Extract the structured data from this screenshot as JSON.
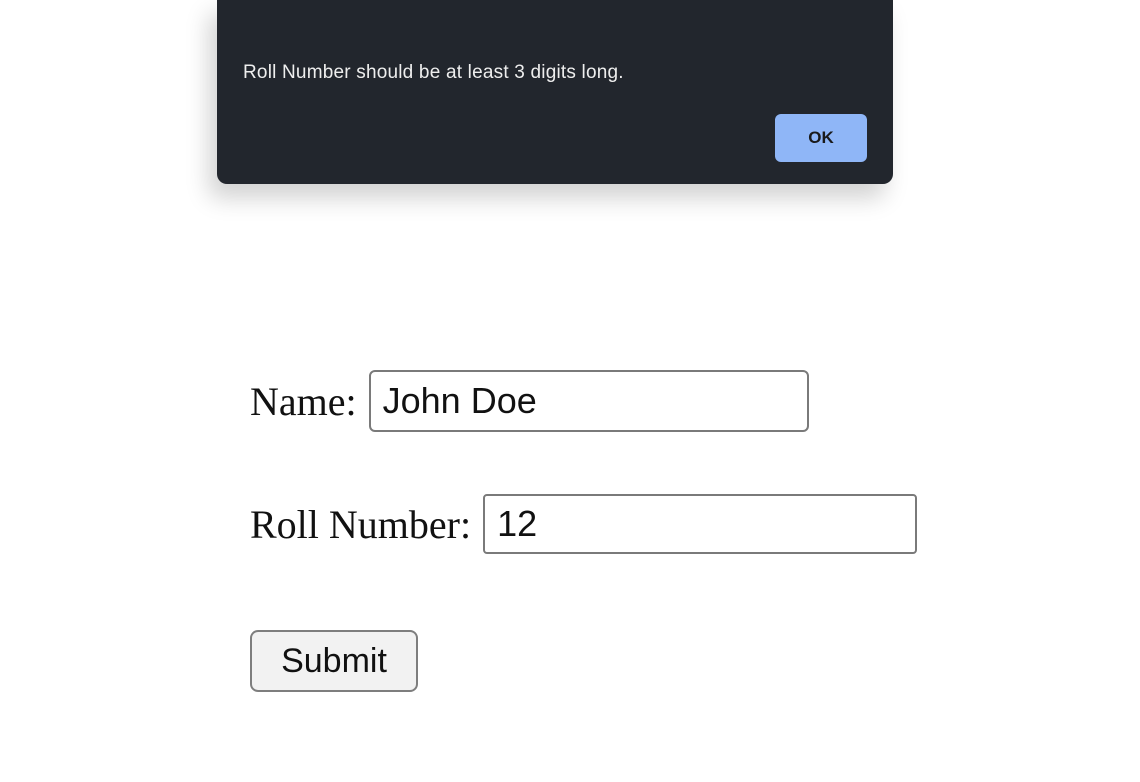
{
  "alert": {
    "message": "Roll Number should be at least 3 digits long.",
    "ok_label": "OK"
  },
  "form": {
    "name_label": "Name:",
    "name_value": "John Doe",
    "roll_label": "Roll Number:",
    "roll_value": "12",
    "submit_label": "Submit"
  }
}
